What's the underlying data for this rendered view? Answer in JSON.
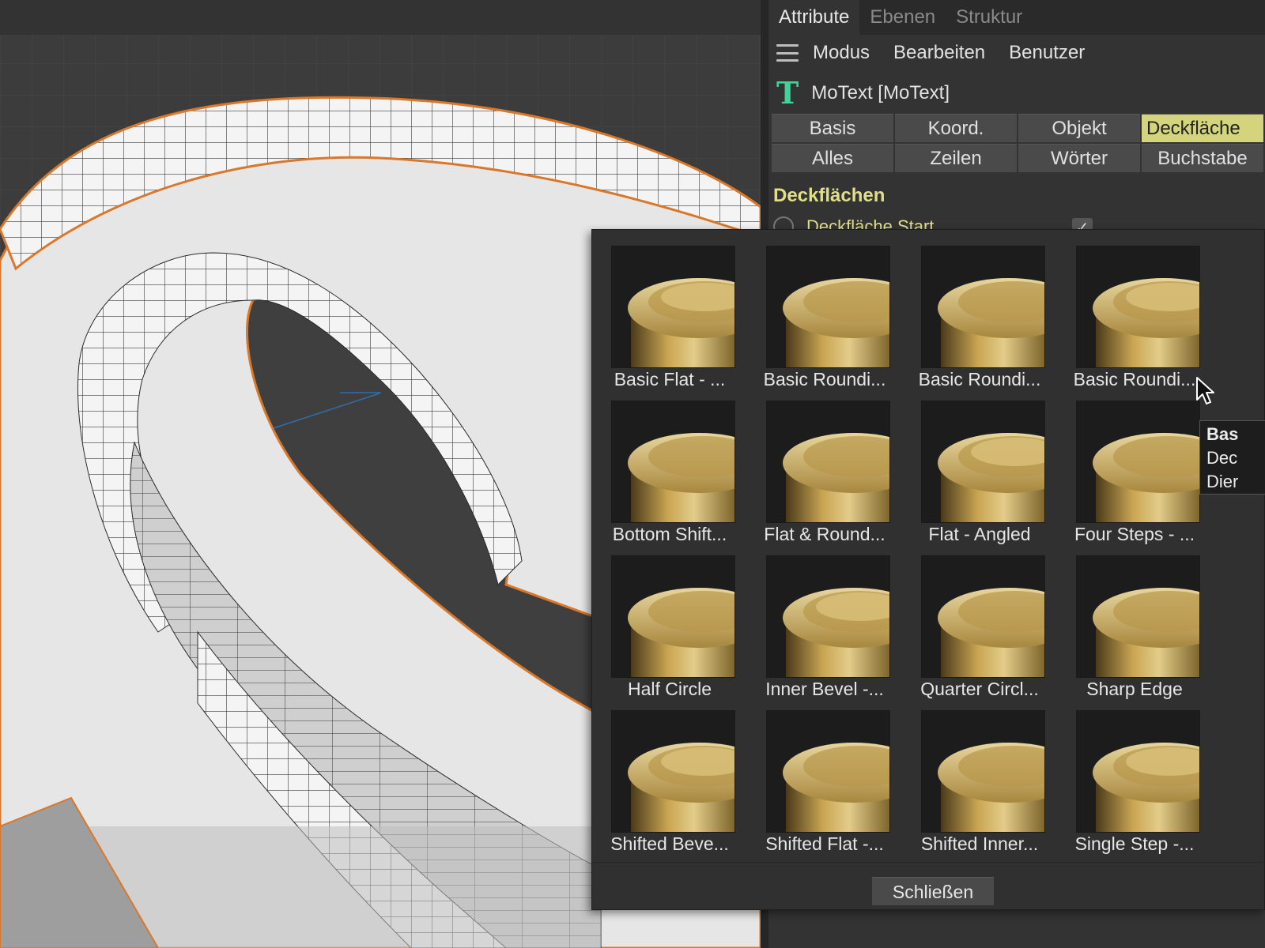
{
  "tabs": [
    "Attribute",
    "Ebenen",
    "Struktur"
  ],
  "menu": [
    "Modus",
    "Bearbeiten",
    "Benutzer"
  ],
  "object": {
    "name": "MoText [MoText]",
    "icon": "motext-t-icon"
  },
  "property_buttons": [
    [
      "Basis",
      "Koord.",
      "Objekt",
      "Deckfläche"
    ],
    [
      "Alles",
      "Zeilen",
      "Wörter",
      "Buchstabe"
    ]
  ],
  "section": {
    "title": "Deckflächen",
    "param_label": "Deckfläche Start"
  },
  "presets": [
    "Basic Flat - ...",
    "Basic Roundi...",
    "Basic Roundi...",
    "Basic Roundi...",
    "Bottom Shift...",
    "Flat & Round...",
    "Flat - Angled",
    "Four Steps - ...",
    "Half Circle",
    "Inner Bevel -...",
    "Quarter Circl...",
    "Sharp Edge",
    "Shifted Beve...",
    "Shifted Flat -...",
    "Shifted Inner...",
    "Single Step -..."
  ],
  "close_button": "Schließen",
  "tooltip": [
    "Bas",
    "Dec",
    "Dier"
  ],
  "colors": {
    "accent": "#d4d47c",
    "section": "#e2df8a",
    "selection_outline": "#d9782a",
    "gold": "#c9a552"
  }
}
